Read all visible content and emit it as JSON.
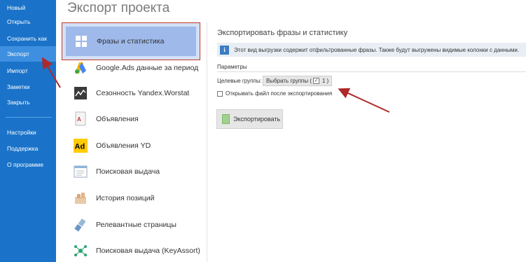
{
  "sidebar": {
    "items": [
      {
        "label": "Новый"
      },
      {
        "label": "Открыть"
      },
      {
        "label": "Сохранить как"
      },
      {
        "label": "Экспорт"
      },
      {
        "label": "Импорт"
      },
      {
        "label": "Заметки"
      },
      {
        "label": "Закрыть"
      },
      {
        "label": "Настройки"
      },
      {
        "label": "Поддержка"
      },
      {
        "label": "О программе"
      }
    ],
    "active": "Экспорт"
  },
  "page_title": "Экспорт проекта",
  "formats": [
    {
      "label": "Фразы и статистика",
      "icon": "table-grid-icon",
      "selected": true
    },
    {
      "label": "Google.Ads данные за период",
      "icon": "google-ads-icon"
    },
    {
      "label": "Сезонность Yandex.Worstat",
      "icon": "seasonality-chart-icon"
    },
    {
      "label": "Объявления",
      "icon": "ads-document-icon"
    },
    {
      "label": "Объявления YD",
      "icon": "yandex-direct-ad-icon"
    },
    {
      "label": "Поисковая выдача",
      "icon": "serp-window-icon"
    },
    {
      "label": "История позиций",
      "icon": "position-history-icon"
    },
    {
      "label": "Релевантные страницы",
      "icon": "relevant-pages-icon"
    },
    {
      "label": "Поисковая выдача (KeyAssort)",
      "icon": "keyassort-cluster-icon"
    }
  ],
  "panel": {
    "title": "Экспортировать фразы и статистику",
    "info": "Этот вид выгрузки содержит отфильтрованные фразы. Также будут выгружены видимые колонки с данными.",
    "params_label": "Параметры",
    "groups_label": "Целевые группы:",
    "groups_button_prefix": "Выбрать группы (",
    "groups_check": "✓",
    "groups_count": "1",
    "groups_button_suffix": ")",
    "open_after_label": "Открывать файл после экспортирования",
    "export_button": "Экспортировать"
  },
  "colors": {
    "sidebar": "#1a73c9",
    "accent_red": "#c0392b",
    "selection": "#9eb9ea"
  }
}
